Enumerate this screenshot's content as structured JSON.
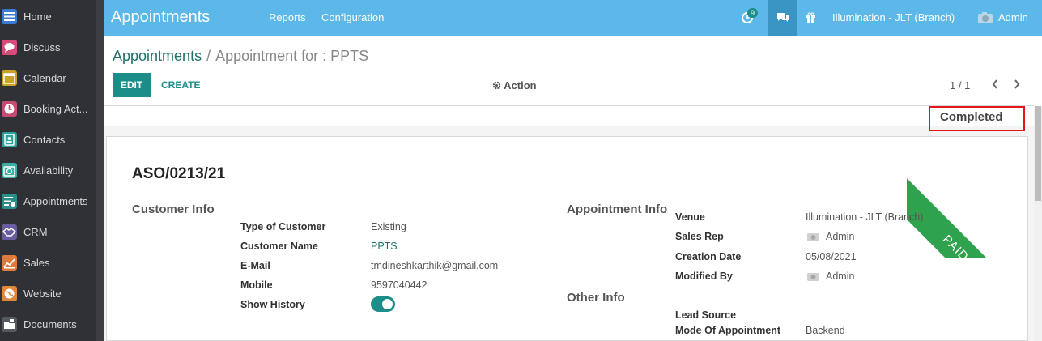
{
  "sidebar": {
    "items": [
      {
        "label": "Home",
        "icon": "home-icon",
        "color": "#3a7bd5"
      },
      {
        "label": "Discuss",
        "icon": "chat-icon",
        "color": "#d64b78"
      },
      {
        "label": "Calendar",
        "icon": "calendar-icon",
        "color": "#c9a227"
      },
      {
        "label": "Booking Act...",
        "icon": "booking-icon",
        "color": "#c74a70"
      },
      {
        "label": "Contacts",
        "icon": "contacts-icon",
        "color": "#2aa39a"
      },
      {
        "label": "Availability",
        "icon": "availability-icon",
        "color": "#39b0a4"
      },
      {
        "label": "Appointments",
        "icon": "appointments-icon",
        "color": "#2a8f8a"
      },
      {
        "label": "CRM",
        "icon": "handshake-icon",
        "color": "#6a5ba3"
      },
      {
        "label": "Sales",
        "icon": "sales-chart-icon",
        "color": "#e07a3a"
      },
      {
        "label": "Website",
        "icon": "globe-icon",
        "color": "#e0873a"
      },
      {
        "label": "Documents",
        "icon": "documents-icon",
        "color": "#555a60"
      }
    ]
  },
  "topbar": {
    "app_title": "Appointments",
    "menu": {
      "reports": "Reports",
      "configuration": "Configuration"
    },
    "activity_count": "9",
    "company": "Illumination - JLT (Branch)",
    "user": "Admin",
    "colors": {
      "bar": "#5bb8e8",
      "active": "#3a95c4"
    }
  },
  "breadcrumb": {
    "parent": "Appointments",
    "separator": "/",
    "current": "Appointment for : PPTS"
  },
  "toolbar": {
    "edit": "EDIT",
    "create": "CREATE",
    "action": "Action",
    "pager": "1 / 1"
  },
  "status": {
    "label": "Completed"
  },
  "ribbon": {
    "label": "PAID",
    "color": "#2ea24d"
  },
  "record": {
    "name": "ASO/0213/21",
    "customer_info": {
      "title": "Customer Info",
      "type_label": "Type of Customer",
      "type_value": "Existing",
      "name_label": "Customer Name",
      "name_value": "PPTS",
      "email_label": "E-Mail",
      "email_value": "tmdineshkarthik@gmail.com",
      "mobile_label": "Mobile",
      "mobile_value": "9597040442",
      "history_label": "Show History",
      "history_enabled": true
    },
    "appointment_info": {
      "title": "Appointment Info",
      "venue_label": "Venue",
      "venue_value": "Illumination - JLT (Branch)",
      "rep_label": "Sales Rep",
      "rep_value": "Admin",
      "created_label": "Creation Date",
      "created_value": "05/08/2021",
      "modified_label": "Modified By",
      "modified_value": "Admin"
    },
    "other_info": {
      "title": "Other Info",
      "lead_label": "Lead Source",
      "lead_value": "",
      "mode_label": "Mode Of Appointment",
      "mode_value": "Backend"
    }
  }
}
